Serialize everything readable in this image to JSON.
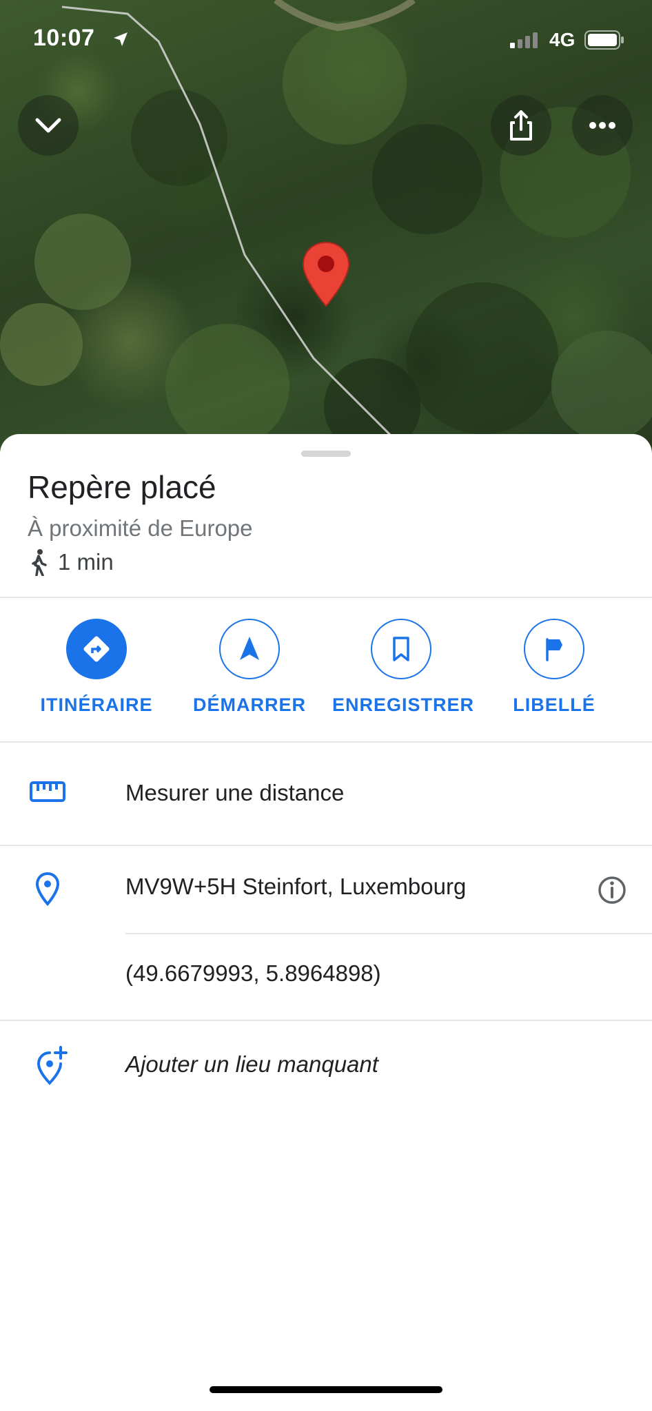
{
  "status": {
    "time": "10:07",
    "network": "4G"
  },
  "map": {
    "collapse_icon": "chevron-down-icon",
    "share_icon": "share-icon",
    "more_icon": "more-horizontal-icon",
    "pin_icon": "map-pin-icon"
  },
  "place": {
    "title": "Repère placé",
    "subtitle": "À proximité de Europe",
    "walk_time": "1 min"
  },
  "actions": [
    {
      "label": "ITINÉRAIRE",
      "icon": "directions-icon"
    },
    {
      "label": "DÉMARRER",
      "icon": "navigation-arrow-icon"
    },
    {
      "label": "ENREGISTRER",
      "icon": "bookmark-icon"
    },
    {
      "label": "LIBELLÉ",
      "icon": "flag-icon"
    }
  ],
  "details": {
    "measure": "Mesurer une distance",
    "plus_code": "MV9W+5H Steinfort, Luxembourg",
    "coordinates": "(49.6679993, 5.8964898)",
    "add_place": "Ajouter un lieu manquant"
  },
  "colors": {
    "accent": "#1a73e8",
    "pin": "#ea4335"
  }
}
